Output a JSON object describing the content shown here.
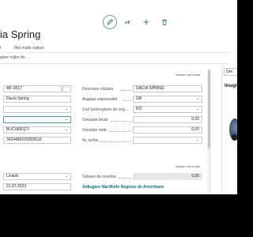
{
  "header": {
    "title": "ia Spring"
  },
  "toolbar": {
    "icons": [
      "edit-icon",
      "share-icon",
      "new-icon",
      "delete-icon"
    ]
  },
  "actions": {
    "first": "t",
    "more_options": "Mai multe opțiuni"
  },
  "breadcrumb": {
    "text": "plere mijloc fix..."
  },
  "general": {
    "show_more": "Afișare mai multe",
    "no": "MF-0017",
    "description_field": "Dacia Spring",
    "location": "BUCUREȘTI",
    "serial_no": "3424489100303510",
    "search_description_label": "Descriere căutare",
    "search_description_value": "DACIA SPRING",
    "responsible_employee_label": "Angajat responsabil",
    "responsible_employee_value": "GB",
    "country_label": "Cod țară/regiune de orig...",
    "country_value": "RO",
    "gross_weight_label": "Greutate brută",
    "gross_weight_value": "0,00",
    "net_weight_label": "Greutate netă",
    "net_weight_value": "0,00",
    "tariff_label": "Nr. tarifar"
  },
  "depreciation": {
    "show_more": "Afișare mai multe",
    "method": "Liniară",
    "start_date": "01.07.2023",
    "inventory_value_label": "Valoare de inventar",
    "inventory_value": "0,00",
    "add_books_link": "Adăugare Mai Multe Registre de Amortizare"
  },
  "factbox": {
    "tab": "Det",
    "heading": "Imagi"
  },
  "colors": {
    "accent": "#0d6b80",
    "teal_border": "#5a9e9a"
  }
}
